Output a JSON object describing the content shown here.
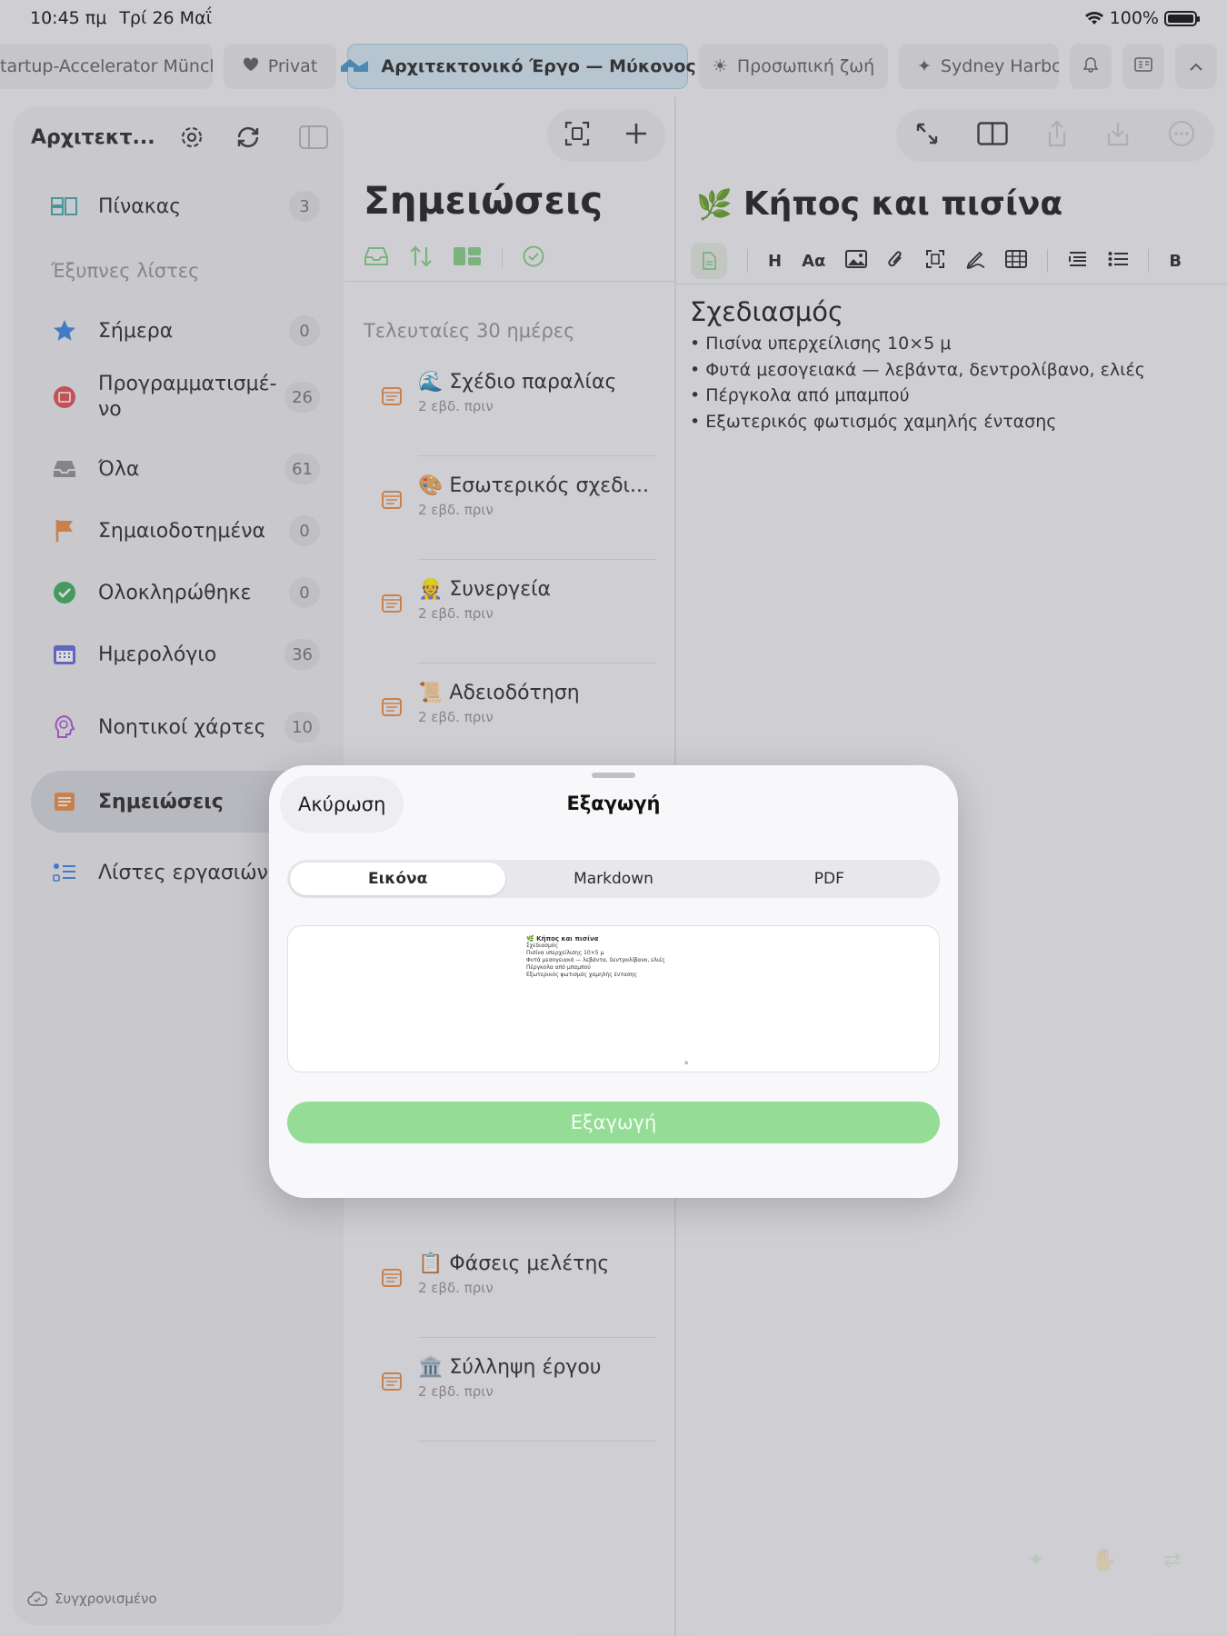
{
  "status_bar": {
    "time": "10:45 πμ",
    "date": "Τρί 26 Μαΐ",
    "battery": "100%"
  },
  "tabs": [
    {
      "label": "tartup-Accelerator München",
      "icon": "none"
    },
    {
      "label": "Privat",
      "icon": "heart-icon"
    },
    {
      "label": "Αρχιτεκτονικό Έργο — Μύκονος",
      "icon": "house-icon",
      "active": true
    },
    {
      "label": "Προσωπική ζωή",
      "icon": "sun-icon"
    },
    {
      "label": "Sydney Harbou",
      "icon": "sparkle-icon"
    }
  ],
  "sidebar": {
    "title": "Αρχιτεκτ...",
    "board": {
      "label": "Πίνακας",
      "count": "3"
    },
    "section_label": "Έξυπνες λίστες",
    "items": [
      {
        "label": "Σήμερα",
        "count": "0"
      },
      {
        "label": "Προγραμματισμέ-\nνο",
        "count": "26"
      },
      {
        "label": "Όλα",
        "count": "61"
      },
      {
        "label": "Σημαιοδοτημένα",
        "count": "0"
      },
      {
        "label": "Ολοκληρώθηκε",
        "count": "0"
      },
      {
        "label": "Ημερολόγιο",
        "count": "36"
      },
      {
        "label": "Νοητικοί χάρτες",
        "count": "10"
      },
      {
        "label": "Σημειώσεις",
        "count": ""
      },
      {
        "label": "Λίστες εργασιών",
        "count": ""
      }
    ],
    "sync_status": "Συγχρονισμένο"
  },
  "notes": {
    "title": "Σημειώσεις",
    "section": "Τελευταίες 30 ημέρες",
    "items": [
      {
        "emoji": "🌊",
        "title": "Σχέδιο παραλίας",
        "date": "2 εβδ. πριν"
      },
      {
        "emoji": "🎨",
        "title": "Εσωτερικός σχεδι...",
        "date": "2 εβδ. πριν"
      },
      {
        "emoji": "👷",
        "title": "Συνεργεία",
        "date": "2 εβδ. πριν"
      },
      {
        "emoji": "📜",
        "title": "Αδειοδότηση",
        "date": "2 εβδ. πριν"
      },
      {
        "emoji": "📋",
        "title": "Φάσεις μελέτης",
        "date": "2 εβδ. πριν"
      },
      {
        "emoji": "🏛️",
        "title": "Σύλληψη έργου",
        "date": "2 εβδ. πριν"
      }
    ]
  },
  "editor": {
    "emoji": "🌿",
    "title": "Κήπος και πισίνα",
    "toolbar": {
      "h": "H",
      "aa": "Αα",
      "b": "B"
    },
    "heading": "Σχεδιασμός",
    "bullets": [
      "Πισίνα υπερχείλισης 10×5 μ",
      "Φυτά μεσογειακά — λεβάντα, δεντρολίβανο, ελιές",
      "Πέργκολα από μπαμπού",
      "Εξωτερικός φωτισμός χαμηλής έντασης"
    ]
  },
  "modal": {
    "cancel_label": "Ακύρωση",
    "title": "Εξαγωγή",
    "segments": [
      "Εικόνα",
      "Markdown",
      "PDF"
    ],
    "selected_segment": "Εικόνα",
    "export_label": "Εξαγωγή"
  },
  "colors": {
    "accent_green": "#95dc97",
    "active_tab": "#cfe3ef",
    "note_icon": "#e8853a"
  }
}
